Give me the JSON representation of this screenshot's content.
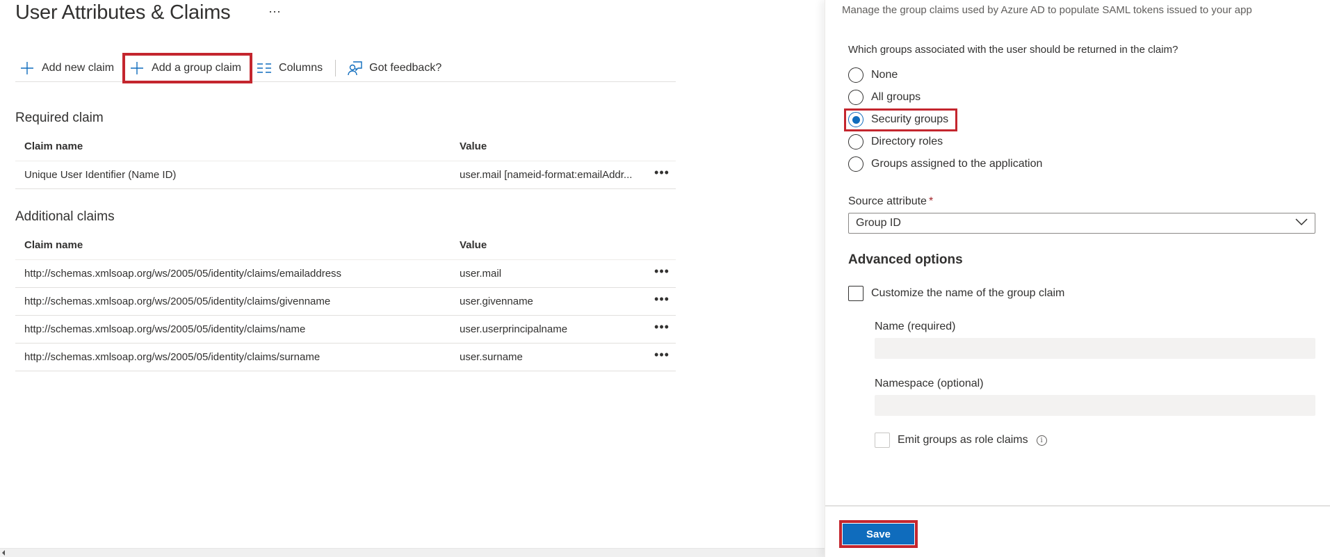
{
  "page": {
    "title": "User Attributes & Claims",
    "more_label": "···"
  },
  "toolbar": {
    "items": [
      {
        "label": "Add new claim",
        "icon": "plus-icon"
      },
      {
        "label": "Add a group claim",
        "icon": "plus-icon",
        "highlighted": true
      },
      {
        "label": "Columns",
        "icon": "columns-icon"
      },
      {
        "label": "Got feedback?",
        "icon": "feedback-icon"
      }
    ]
  },
  "required_claim": {
    "title": "Required claim",
    "columns": [
      "Claim name",
      "Value"
    ],
    "rows": [
      {
        "name": "Unique User Identifier (Name ID)",
        "value": "user.mail [nameid-format:emailAddr...",
        "actions": "•••"
      }
    ]
  },
  "additional_claims": {
    "title": "Additional claims",
    "columns": [
      "Claim name",
      "Value"
    ],
    "rows": [
      {
        "name": "http://schemas.xmlsoap.org/ws/2005/05/identity/claims/emailaddress",
        "value": "user.mail",
        "actions": "•••"
      },
      {
        "name": "http://schemas.xmlsoap.org/ws/2005/05/identity/claims/givenname",
        "value": "user.givenname",
        "actions": "•••"
      },
      {
        "name": "http://schemas.xmlsoap.org/ws/2005/05/identity/claims/name",
        "value": "user.userprincipalname",
        "actions": "•••"
      },
      {
        "name": "http://schemas.xmlsoap.org/ws/2005/05/identity/claims/surname",
        "value": "user.surname",
        "actions": "•••"
      }
    ]
  },
  "panel": {
    "subtitle": "Manage the group claims used by Azure AD to populate SAML tokens issued to your app",
    "question": "Which groups associated with the user should be returned in the claim?",
    "radio_options": [
      {
        "label": "None",
        "checked": false
      },
      {
        "label": "All groups",
        "checked": false
      },
      {
        "label": "Security groups",
        "checked": true
      },
      {
        "label": "Directory roles",
        "checked": false
      },
      {
        "label": "Groups assigned to the application",
        "checked": false
      }
    ],
    "source_attribute": {
      "label": "Source attribute",
      "required_mark": "*",
      "selected": "Group ID"
    },
    "advanced": {
      "title": "Advanced options",
      "customize_label": "Customize the name of the group claim",
      "customize_checked": false,
      "name_label": "Name (required)",
      "name_value": "",
      "namespace_label": "Namespace (optional)",
      "namespace_value": "",
      "emit_label": "Emit groups as role claims",
      "emit_checked": false,
      "info_glyph": "i"
    },
    "save_label": "Save"
  },
  "colors": {
    "accent": "#0f6cbd",
    "highlight": "#c4262e",
    "required": "#a4262c"
  }
}
